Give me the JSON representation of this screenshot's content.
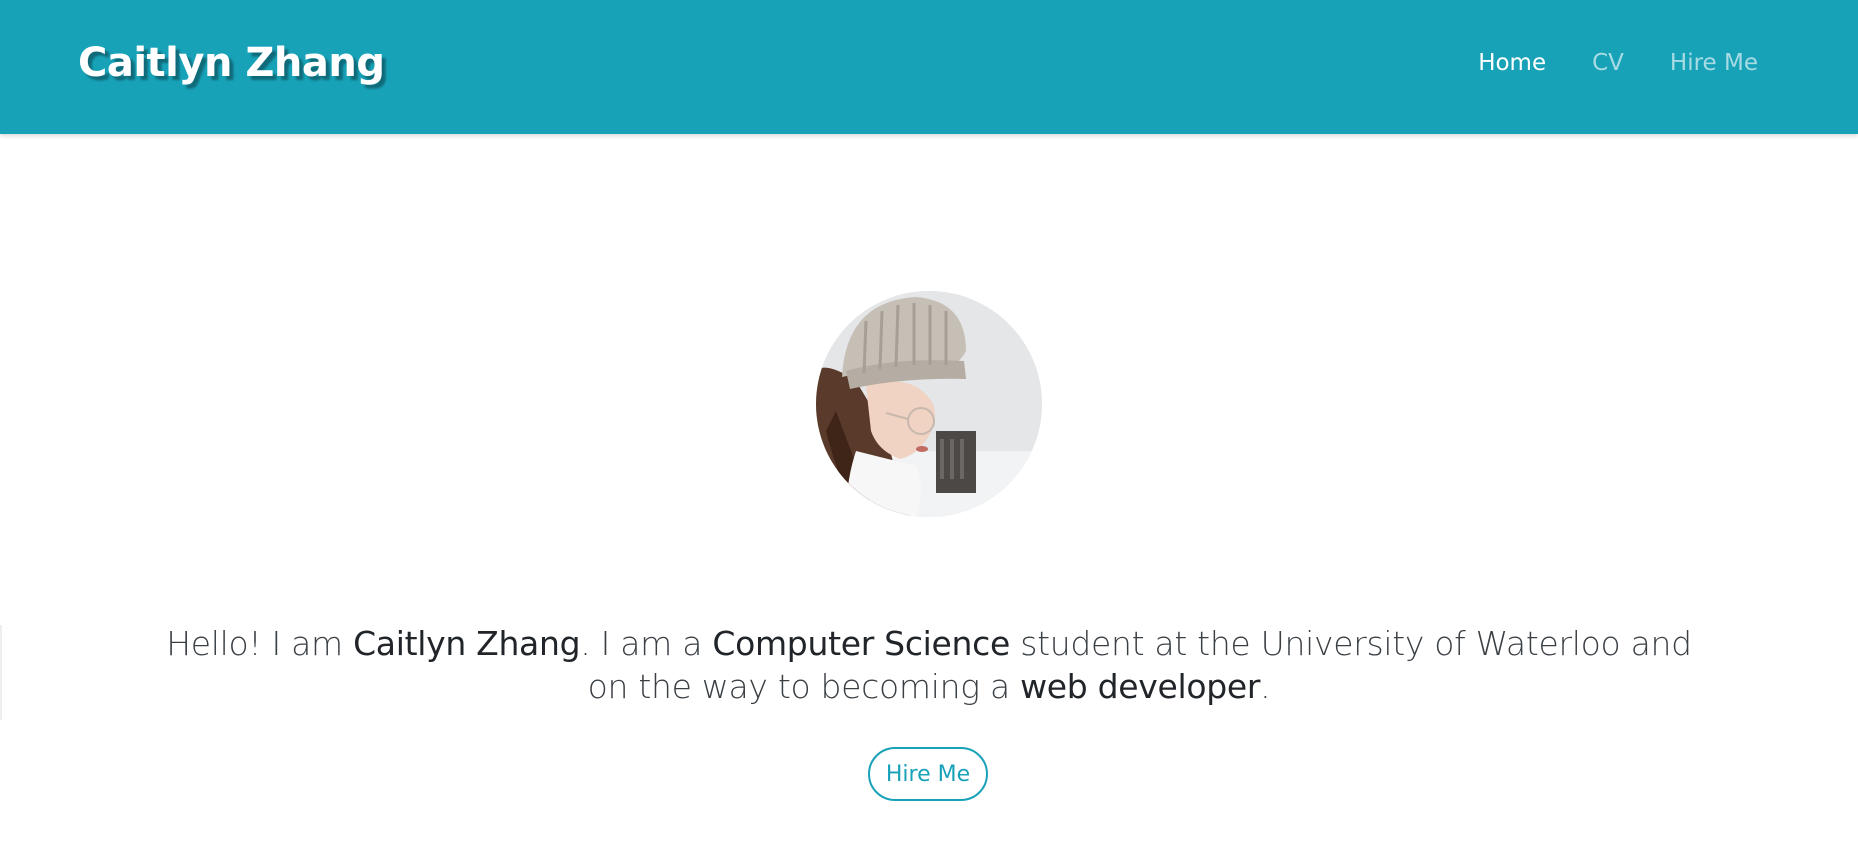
{
  "navbar": {
    "brand": "Caitlyn Zhang",
    "links": [
      {
        "label": "Home",
        "active": true
      },
      {
        "label": "CV",
        "active": false
      },
      {
        "label": "Hire Me",
        "active": false
      }
    ],
    "background_color": "#18a2b8"
  },
  "hero": {
    "avatar_icon": "profile-photo",
    "intro": {
      "t1": "Hello! I am ",
      "name": "Caitlyn Zhang",
      "t2": ". I am a ",
      "major": "Computer Science",
      "t3": " student at the University of Waterloo and on the way to becoming a ",
      "goal": "web developer",
      "t4": "."
    },
    "cta_label": "Hire Me"
  },
  "colors": {
    "accent": "#18a2b8",
    "nav_inactive": "#a7dbe3",
    "text": "#212529"
  }
}
